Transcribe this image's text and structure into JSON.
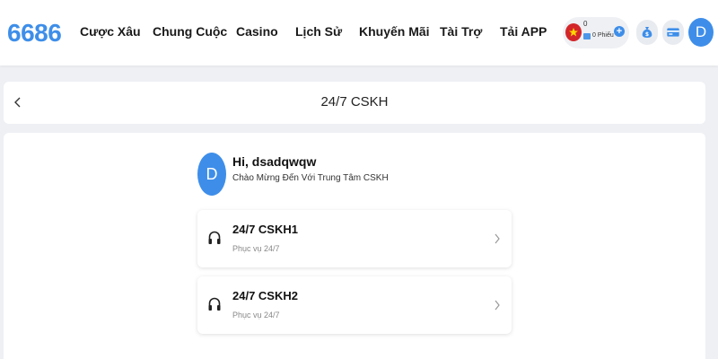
{
  "brand": {
    "logo": "6686",
    "accent": "#3e8ee9"
  },
  "nav": {
    "items": [
      {
        "label": "Cược Xâu"
      },
      {
        "label": "Chung Cuộc"
      },
      {
        "label": "Casino"
      },
      {
        "label": "Lịch Sử"
      },
      {
        "label": "Khuyến Mãi"
      },
      {
        "label": "Tài Trợ"
      },
      {
        "label": "Tải APP"
      }
    ]
  },
  "wallet": {
    "amount": "0",
    "tickets": "0 Phiếu",
    "flag_icon": "vietnam-flag-icon",
    "add_icon": "plus-icon"
  },
  "header_actions": {
    "money_bag_icon": "money-bag-icon",
    "card_icon": "card-icon",
    "avatar_letter": "D"
  },
  "page": {
    "title": "24/7 CSKH",
    "back_icon": "chevron-left-icon"
  },
  "user": {
    "avatar_letter": "D",
    "greeting": "Hi, dsadqwqw",
    "welcome": "Chào Mừng Đến Với Trung Tâm CSKH"
  },
  "support": [
    {
      "title": "24/7 CSKH1",
      "subtitle": "Phục vụ 24/7",
      "icon": "headphones-icon"
    },
    {
      "title": "24/7 CSKH2",
      "subtitle": "Phục vụ 24/7",
      "icon": "headphones-icon"
    }
  ]
}
